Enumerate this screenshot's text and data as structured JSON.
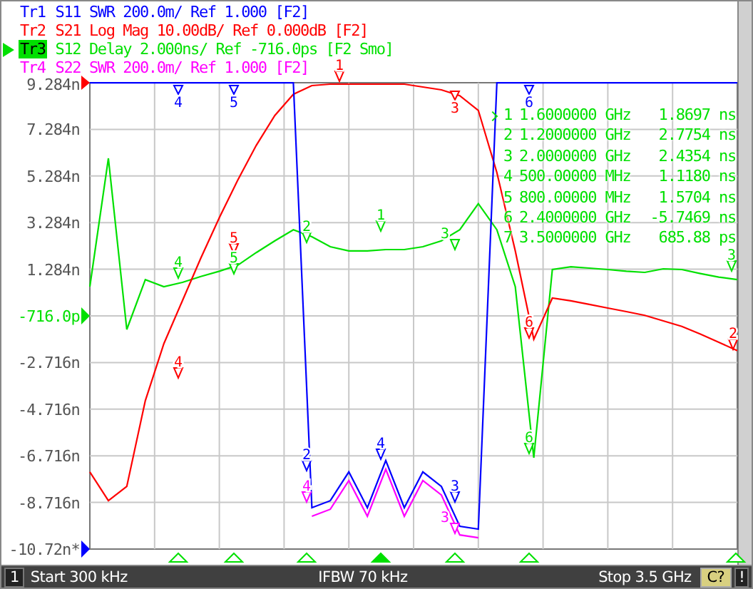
{
  "traces": [
    {
      "name": "Tr1",
      "text": "S11 SWR 200.0m/ Ref 1.000 [F2]",
      "color": "#0000ff",
      "selected": false,
      "markers": [
        {
          "label": "4"
        },
        {
          "label": "5"
        },
        {
          "label": "6"
        },
        {
          "label": "2"
        },
        {
          "label": "4"
        },
        {
          "label": "3"
        }
      ]
    },
    {
      "name": "Tr2",
      "text": "S21 Log Mag 10.00dB/ Ref 0.000dB [F2]",
      "color": "#ff0000",
      "selected": false,
      "markers": [
        {
          "label": "1"
        },
        {
          "label": "3"
        },
        {
          "label": "4"
        },
        {
          "label": "5"
        },
        {
          "label": "6"
        },
        {
          "label": "2"
        }
      ]
    },
    {
      "name": "Tr3",
      "text": "S12 Delay 2.000ns/ Ref -716.0ps [F2 Smo]",
      "color": "#00e000",
      "selected": true,
      "markers": [
        {
          "label": "1"
        },
        {
          "label": "2"
        },
        {
          "label": "3"
        },
        {
          "label": "4"
        },
        {
          "label": "5"
        },
        {
          "label": "6"
        },
        {
          "label": "3"
        }
      ]
    },
    {
      "name": "Tr4",
      "text": "S22 SWR 200.0m/ Ref 1.000 [F2]",
      "color": "#ff00ff",
      "selected": false,
      "markers": [
        {
          "label": "4"
        },
        {
          "label": "3"
        }
      ]
    }
  ],
  "plot": {
    "reference_label": {
      "text": "-716.0p",
      "reference": true
    },
    "chart_data": {
      "type": "line",
      "categories": [
        null,
        null,
        null,
        null,
        null,
        null,
        null,
        null,
        null,
        null,
        null,
        null,
        null,
        null,
        null,
        null,
        null,
        null,
        null,
        null,
        null,
        null,
        null,
        null,
        null,
        null,
        null,
        null,
        null,
        null,
        null,
        null,
        null,
        null,
        null,
        null
      ],
      "ylim": [
        -10.716,
        9.284
      ],
      "yticks": [
        {
          "value": 9.284,
          "label": "9.284n"
        },
        {
          "value": 7.284,
          "label": "7.284n"
        },
        {
          "value": 5.284,
          "label": "5.284n"
        },
        {
          "value": 3.284,
          "label": "3.284n"
        },
        {
          "value": 1.284,
          "label": "1.284n"
        },
        {
          "value": -2.716,
          "label": "-2.716n"
        },
        {
          "value": -4.716,
          "label": "-4.716n"
        },
        {
          "value": -6.716,
          "label": "-6.716n"
        },
        {
          "value": -8.716,
          "label": "-8.716n"
        },
        {
          "value": -10.716,
          "label": "-10.72n*"
        }
      ],
      "series": [
        {
          "color": "#0000ff",
          "values": [
            9.28,
            9.28,
            9.28,
            9.28,
            9.28,
            9.28,
            9.28,
            9.28,
            9.28,
            9.28,
            9.28,
            9.28,
            -8.94,
            -8.64,
            -7.41,
            -8.94,
            -6.92,
            -8.94,
            -7.41,
            -8.03,
            -9.74,
            -9.86,
            9.28,
            9.28,
            9.28,
            9.28,
            9.28,
            9.28,
            9.28,
            9.28,
            9.28,
            9.28,
            9.28,
            9.28,
            9.28,
            9.28
          ]
        },
        {
          "color": "#ff0000",
          "values": [
            -7.41,
            -8.64,
            -8.03,
            -4.35,
            -1.91,
            -0.07,
            1.76,
            3.5,
            5.12,
            6.6,
            7.88,
            8.79,
            9.16,
            9.22,
            9.22,
            9.22,
            9.22,
            9.22,
            9.1,
            8.98,
            8.73,
            8.1,
            5.43,
            2.07,
            -1.72,
            0.05,
            -0.07,
            -0.22,
            -0.38,
            -0.53,
            -0.69,
            -0.93,
            -1.17,
            -1.5,
            -1.85,
            -2.21
          ]
        },
        {
          "color": "#00e000",
          "values": [
            0.54,
            6.04,
            -1.3,
            0.84,
            0.54,
            0.72,
            0.97,
            1.2,
            1.46,
            2.0,
            2.5,
            2.98,
            2.68,
            2.25,
            2.07,
            2.07,
            2.13,
            2.13,
            2.25,
            2.5,
            2.98,
            4.1,
            2.98,
            0.54,
            -6.8,
            1.27,
            1.39,
            1.33,
            1.27,
            1.2,
            1.15,
            1.3,
            1.27,
            1.1,
            0.95,
            0.84
          ]
        },
        {
          "color": "#ff00ff",
          "values": [
            null,
            null,
            null,
            null,
            null,
            null,
            null,
            null,
            null,
            null,
            null,
            null,
            -9.31,
            -9.01,
            -7.78,
            -9.31,
            -7.29,
            -9.31,
            -7.78,
            -8.4,
            -10.11,
            -10.23,
            null,
            null,
            null,
            null,
            null,
            null,
            null,
            null,
            null,
            null,
            null,
            null,
            null,
            null
          ]
        }
      ],
      "grid": true
    }
  },
  "marker_table": [
    {
      "number": "1",
      "frequency": "1.6000000 GHz",
      "value": "1.8697 ns",
      "selected": true
    },
    {
      "number": "2",
      "frequency": "1.2000000 GHz",
      "value": "2.7754 ns",
      "selected": false
    },
    {
      "number": "3",
      "frequency": "2.0000000 GHz",
      "value": "2.4354 ns",
      "selected": false
    },
    {
      "number": "4",
      "frequency": "500.00000 MHz",
      "value": "1.1180 ns",
      "selected": false
    },
    {
      "number": "5",
      "frequency": "800.00000 MHz",
      "value": "1.5704 ns",
      "selected": false
    },
    {
      "number": "6",
      "frequency": "2.4000000 GHz",
      "value": "-5.7469 ns",
      "selected": false
    },
    {
      "number": "7",
      "frequency": "3.5000000 GHz",
      "value": "685.88 ps",
      "selected": false
    }
  ],
  "stimulus_markers": [
    {
      "selected": false
    },
    {
      "selected": false
    },
    {
      "selected": false
    },
    {
      "selected": true
    },
    {
      "selected": false
    },
    {
      "selected": false
    },
    {
      "selected": false
    }
  ],
  "status_bar": {
    "channel": "1",
    "start": "Start 300 kHz",
    "ifbw": "IFBW 70 kHz",
    "stop": "Stop 3.5 GHz",
    "calibration": "C?",
    "alert": "!"
  }
}
